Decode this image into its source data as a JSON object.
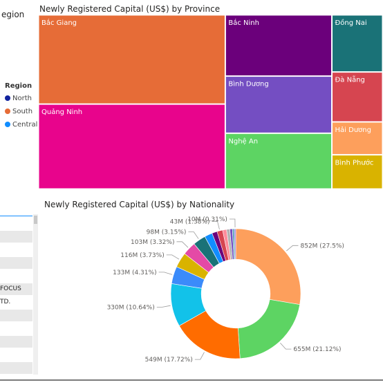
{
  "region_slicer": {
    "title_fragment": "egion",
    "legend_title": "Region",
    "items": [
      {
        "label": "North",
        "color": "#12239e"
      },
      {
        "label": "South",
        "color": "#e66c37"
      },
      {
        "label": "Central",
        "color": "#118dff"
      }
    ]
  },
  "left_table": {
    "rows": [
      {
        "text": "",
        "shade": false
      },
      {
        "text": "",
        "shade": true
      },
      {
        "text": "",
        "shade": false
      },
      {
        "text": "",
        "shade": true
      },
      {
        "text": "",
        "shade": false
      },
      {
        "text": "FOCUS",
        "shade": true
      },
      {
        "text": "TD.",
        "shade": false
      },
      {
        "text": "",
        "shade": true
      },
      {
        "text": "",
        "shade": false
      },
      {
        "text": "",
        "shade": true
      },
      {
        "text": "",
        "shade": false
      },
      {
        "text": "",
        "shade": true
      },
      {
        "text": "",
        "shade": false
      }
    ]
  },
  "chart_data": [
    {
      "type": "treemap",
      "title": "Newly Registered Capital (US$) by Province",
      "nodes": [
        {
          "name": "Bắc Giang",
          "value": 230,
          "color": "#e66c37"
        },
        {
          "name": "Quảng Ninh",
          "value": 219,
          "color": "#e8048c"
        },
        {
          "name": "Bắc Ninh",
          "value": 90,
          "color": "#6b007b"
        },
        {
          "name": "Bình Dương",
          "value": 84,
          "color": "#744ec2"
        },
        {
          "name": "Nghệ An",
          "value": 82,
          "color": "#5dd463"
        },
        {
          "name": "Đồng Nai",
          "value": 40,
          "color": "#1a7277"
        },
        {
          "name": "Đà Nẵng",
          "value": 35,
          "color": "#d64550"
        },
        {
          "name": "Hải Dương",
          "value": 23,
          "color": "#fd9f5c"
        },
        {
          "name": "Bình Phước",
          "value": 24,
          "color": "#d9b300"
        }
      ]
    },
    {
      "type": "pie",
      "title": "Newly Registered Capital (US$) by Nationality",
      "slices": [
        {
          "label": "852M (27.5%)",
          "value": 852,
          "color": "#fd9f5c"
        },
        {
          "label": "655M (21.12%)",
          "value": 655,
          "color": "#5dd463"
        },
        {
          "label": "549M (17.72%)",
          "value": 549,
          "color": "#ff6c00"
        },
        {
          "label": "330M (10.64%)",
          "value": 330,
          "color": "#12c2e9"
        },
        {
          "label": "133M (4.31%)",
          "value": 133,
          "color": "#3b8bfa"
        },
        {
          "label": "116M (3.73%)",
          "value": 116,
          "color": "#d9b300"
        },
        {
          "label": "103M (3.32%)",
          "value": 103,
          "color": "#e44aa6"
        },
        {
          "label": "98M (3.15%)",
          "value": 98,
          "color": "#1a7277"
        },
        {
          "label": "",
          "value": 60,
          "color": "#118dff"
        },
        {
          "label": "",
          "value": 40,
          "color": "#6b007b"
        },
        {
          "label": "43M (1.38%)",
          "value": 43,
          "color": "#d64550"
        },
        {
          "label": "",
          "value": 30,
          "color": "#ff8c9a"
        },
        {
          "label": "",
          "value": 25,
          "color": "#b3b3b3"
        },
        {
          "label": "",
          "value": 20,
          "color": "#744ec2"
        },
        {
          "label": "",
          "value": 15,
          "color": "#5fa8b8"
        },
        {
          "label": "10M (0.31%)",
          "value": 10,
          "color": "#8c6fe0"
        }
      ],
      "inner_radius_ratio": 0.53
    }
  ]
}
